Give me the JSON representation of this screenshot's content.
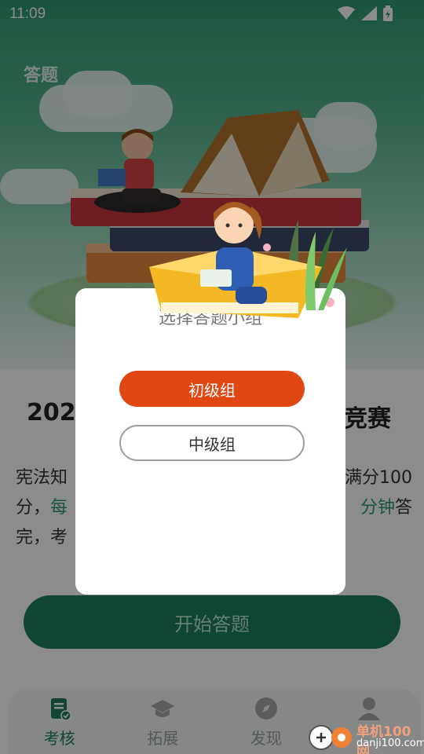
{
  "status_bar": {
    "time": "11:09"
  },
  "page": {
    "title": "答题"
  },
  "competition": {
    "title_start": "2024",
    "title_end": "竞赛"
  },
  "description": {
    "line1_start": "宪法知",
    "line1_end": "满分100",
    "line2_start": "分，",
    "line2_hl1": "每",
    "line2_hl2": "分钟",
    "line2_end": "答",
    "line3": "完，考"
  },
  "start_button": {
    "label": "开始答题"
  },
  "modal": {
    "title": "选择答题小组",
    "primary_option": "初级组",
    "secondary_option": "中级组"
  },
  "tabs": [
    {
      "label": "考核",
      "icon": "clipboard-check-icon",
      "active": true
    },
    {
      "label": "拓展",
      "icon": "graduation-cap-icon",
      "active": false
    },
    {
      "label": "发现",
      "icon": "compass-icon",
      "active": false
    },
    {
      "label": "",
      "icon": "user-icon",
      "active": false
    }
  ],
  "watermark": {
    "line1": "单机100网",
    "line2": "danji100.com"
  },
  "colors": {
    "primary_green": "#1e7f5b",
    "highlight_green": "#2a9b74",
    "primary_orange": "#e04713"
  }
}
